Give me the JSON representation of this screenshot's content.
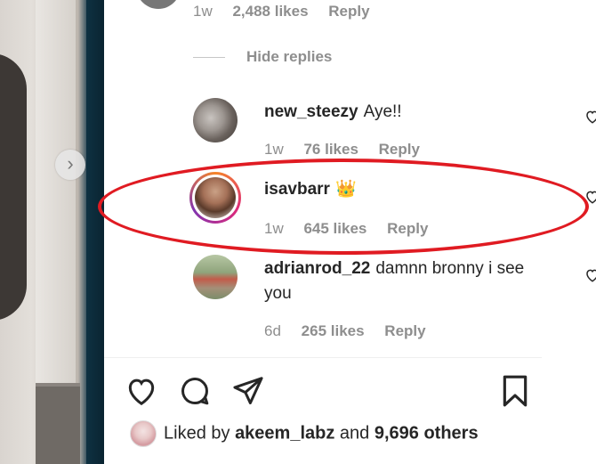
{
  "top_meta": {
    "time": "1w",
    "likes": "2,488 likes",
    "reply": "Reply"
  },
  "hide_replies": "Hide replies",
  "comments": [
    {
      "user": "new_steezy",
      "text": "Aye!!",
      "time": "1w",
      "likes": "76 likes",
      "reply": "Reply"
    },
    {
      "user": "isavbarr",
      "text": "",
      "emoji": "👑",
      "time": "1w",
      "likes": "645 likes",
      "reply": "Reply"
    },
    {
      "user": "adrianrod_22",
      "text": "damnn bronny i see you",
      "time": "6d",
      "likes": "265 likes",
      "reply": "Reply"
    }
  ],
  "liked_by": {
    "prefix": "Liked by",
    "user": "akeem_labz",
    "conjunction": "and",
    "others": "9,696 others"
  },
  "icons": [
    "chevron-right-icon",
    "heart-icon",
    "comment-icon",
    "share-icon",
    "bookmark-icon"
  ],
  "colors": {
    "highlight_ellipse": "#e01b22",
    "meta_gray": "#8e8e8e",
    "text": "#262626"
  }
}
